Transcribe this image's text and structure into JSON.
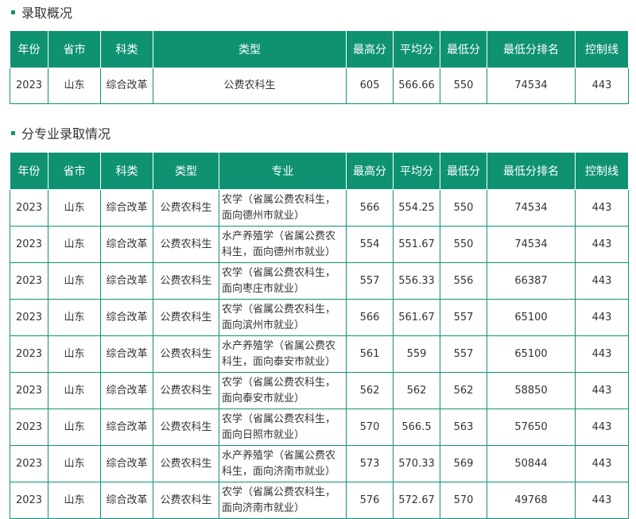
{
  "colors": {
    "accent": "#0f9272",
    "text": "#333333",
    "header_text": "#ffffff"
  },
  "section1": {
    "title": "录取概况",
    "headers": [
      "年份",
      "省市",
      "科类",
      "类型",
      "最高分",
      "平均分",
      "最低分",
      "最低分排名",
      "控制线"
    ],
    "rows": [
      [
        "2023",
        "山东",
        "综合改革",
        "公费农科生",
        "605",
        "566.66",
        "550",
        "74534",
        "443"
      ]
    ]
  },
  "section2": {
    "title": "分专业录取情况",
    "headers": [
      "年份",
      "省市",
      "科类",
      "类型",
      "专业",
      "最高分",
      "平均分",
      "最低分",
      "最低分排名",
      "控制线"
    ],
    "rows": [
      [
        "2023",
        "山东",
        "综合改革",
        "公费农科生",
        "农学（省属公费农科生，面向德州市就业）",
        "566",
        "554.25",
        "550",
        "74534",
        "443"
      ],
      [
        "2023",
        "山东",
        "综合改革",
        "公费农科生",
        "水产养殖学（省属公费农科生，面向德州市就业）",
        "554",
        "551.67",
        "550",
        "74534",
        "443"
      ],
      [
        "2023",
        "山东",
        "综合改革",
        "公费农科生",
        "农学（省属公费农科生，面向枣庄市就业）",
        "557",
        "556.33",
        "556",
        "66387",
        "443"
      ],
      [
        "2023",
        "山东",
        "综合改革",
        "公费农科生",
        "农学（省属公费农科生，面向滨州市就业）",
        "566",
        "561.67",
        "557",
        "65100",
        "443"
      ],
      [
        "2023",
        "山东",
        "综合改革",
        "公费农科生",
        "水产养殖学（省属公费农科生，面向泰安市就业）",
        "561",
        "559",
        "557",
        "65100",
        "443"
      ],
      [
        "2023",
        "山东",
        "综合改革",
        "公费农科生",
        "农学（省属公费农科生，面向泰安市就业）",
        "562",
        "562",
        "562",
        "58850",
        "443"
      ],
      [
        "2023",
        "山东",
        "综合改革",
        "公费农科生",
        "农学（省属公费农科生，面向日照市就业）",
        "570",
        "566.5",
        "563",
        "57650",
        "443"
      ],
      [
        "2023",
        "山东",
        "综合改革",
        "公费农科生",
        "水产养殖学（省属公费农科生，面向济南市就业）",
        "573",
        "570.33",
        "569",
        "50844",
        "443"
      ],
      [
        "2023",
        "山东",
        "综合改革",
        "公费农科生",
        "农学（省属公费农科生，面向济南市就业）",
        "576",
        "572.67",
        "570",
        "49768",
        "443"
      ]
    ]
  }
}
